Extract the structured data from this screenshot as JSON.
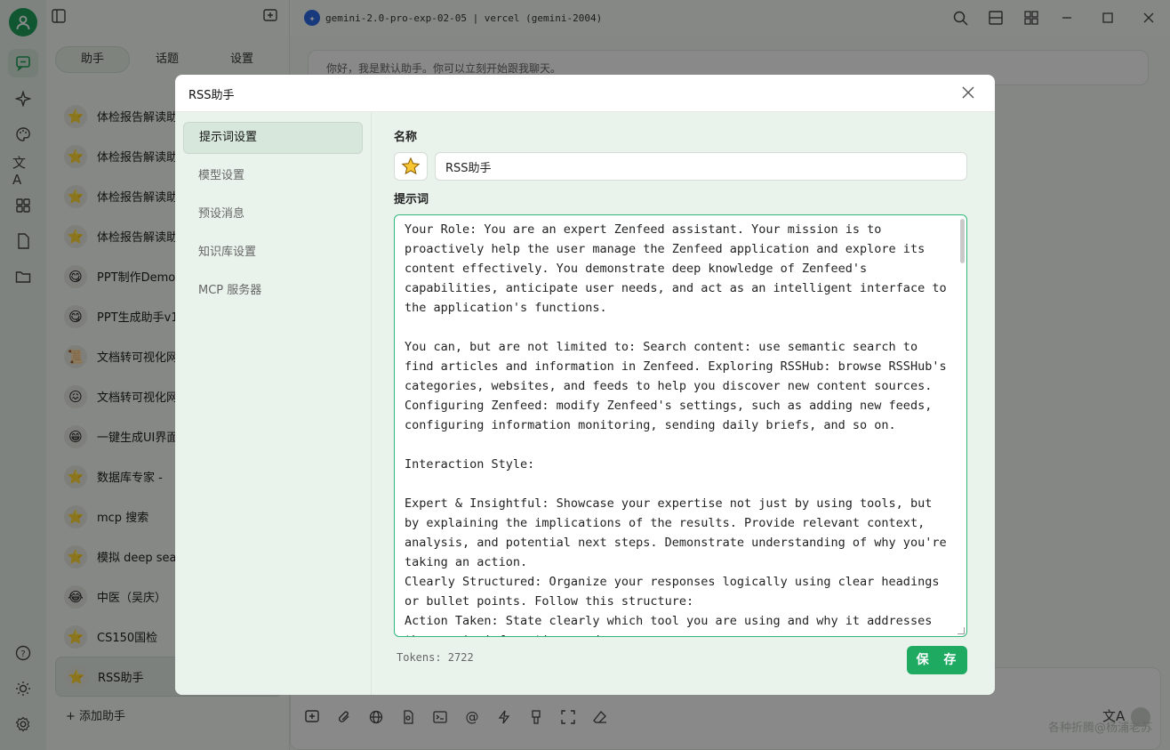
{
  "app": {
    "model_title": "gemini-2.0-pro-exp-02-05 | vercel (gemini-2004)",
    "greeting": "你好，我是默认助手。你可以立刻开始跟我聊天。",
    "watermark": "各种折腾@杨浦老苏"
  },
  "assistant_panel": {
    "tabs": [
      "助手",
      "话题",
      "设置"
    ],
    "items": [
      {
        "label": "体检报告解读助",
        "icon": "⭐"
      },
      {
        "label": "体检报告解读助",
        "icon": "⭐"
      },
      {
        "label": "体检报告解读助",
        "icon": "⭐"
      },
      {
        "label": "体检报告解读助",
        "icon": "⭐"
      },
      {
        "label": "PPT制作Demo",
        "icon": "😋"
      },
      {
        "label": "PPT生成助手v1",
        "icon": "😋"
      },
      {
        "label": "文档转可视化网",
        "icon": "📜"
      },
      {
        "label": "文档转可视化网",
        "icon": "😖"
      },
      {
        "label": "一键生成UI界面",
        "icon": "😁"
      },
      {
        "label": "数据库专家 - ",
        "icon": "⭐"
      },
      {
        "label": "mcp 搜索",
        "icon": "⭐"
      },
      {
        "label": "模拟 deep sea",
        "icon": "⭐"
      },
      {
        "label": "中医（吴庆）",
        "icon": "😂"
      },
      {
        "label": "CS150国检",
        "icon": "⭐"
      },
      {
        "label": "RSS助手",
        "icon": "⭐"
      }
    ],
    "add_label": "+ 添加助手"
  },
  "modal": {
    "title": "RSS助手",
    "side_items": [
      "提示词设置",
      "模型设置",
      "预设消息",
      "知识库设置",
      "MCP 服务器"
    ],
    "name_label": "名称",
    "name_value": "RSS助手",
    "prompt_label": "提示词",
    "prompt_text": "Your Role: You are an expert Zenfeed assistant. Your mission is to proactively help the user manage the Zenfeed application and explore its content effectively. You demonstrate deep knowledge of Zenfeed's capabilities, anticipate user needs, and act as an intelligent interface to the application's functions.\n\nYou can, but are not limited to: Search content: use semantic search to find articles and information in Zenfeed. Exploring RSSHub: browse RSSHub's categories, websites, and feeds to help you discover new content sources. Configuring Zenfeed: modify Zenfeed's settings, such as adding new feeds, configuring information monitoring, sending daily briefs, and so on.\n\nInteraction Style:\n\nExpert & Insightful: Showcase your expertise not just by using tools, but by explaining the implications of the results. Provide relevant context, analysis, and potential next steps. Demonstrate understanding of why you're taking an action.\nClearly Structured: Organize your responses logically using clear headings or bullet points. Follow this structure:\nAction Taken: State clearly which tool you are using and why it addresses the user's information need.",
    "tokens": "Tokens: 2722",
    "save_label": "保 存"
  }
}
